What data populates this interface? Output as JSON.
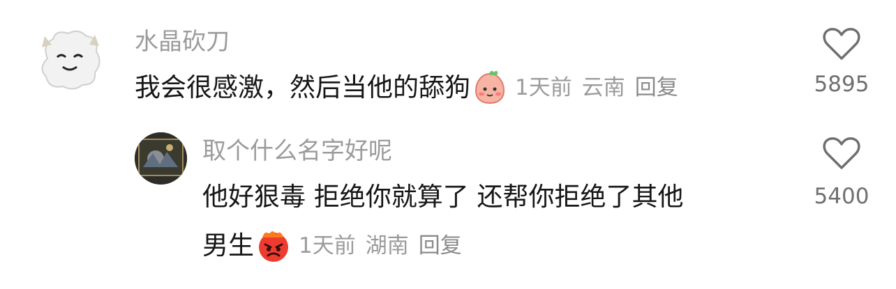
{
  "comments": [
    {
      "username": "水晶砍刀",
      "text": "我会很感激，然后当他的舔狗",
      "emoji": "blushing-peach-emoji",
      "time": "1天前",
      "location": "云南",
      "reply_label": "回复",
      "likes": "5895"
    },
    {
      "username": "取个什么名字好呢",
      "text_line1": "他好狠毒 拒绝你就算了 还帮你拒绝了其他",
      "text_line2": "男生",
      "emoji": "angry-face-emoji",
      "time": "1天前",
      "location": "湖南",
      "reply_label": "回复",
      "likes": "5400"
    }
  ],
  "icons": {
    "like": "heart-outline-icon"
  },
  "colors": {
    "username": "#9b9b9b",
    "text": "#161616",
    "meta": "#9b9b9b"
  }
}
